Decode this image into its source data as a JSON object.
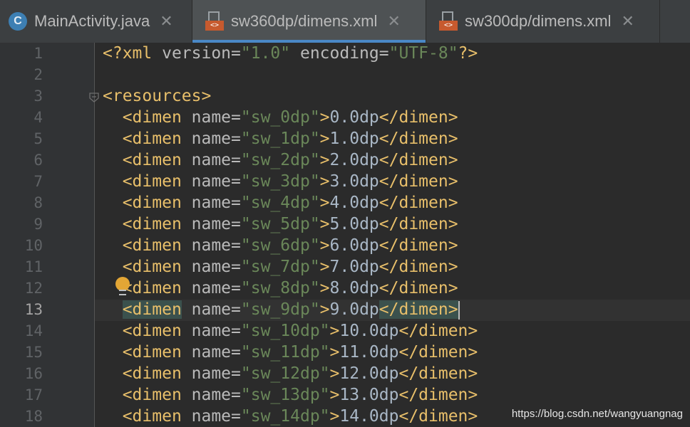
{
  "tabs": [
    {
      "label": "MainActivity.java",
      "icon": "java-class-icon",
      "active": false
    },
    {
      "label": "sw360dp/dimens.xml",
      "icon": "xml-file-icon",
      "active": true
    },
    {
      "label": "sw300dp/dimens.xml",
      "icon": "xml-file-icon",
      "active": false
    }
  ],
  "tab_close_glyph": "✕",
  "java_icon_letter": "C",
  "xml_icon_text": "<>",
  "current_line": 13,
  "line_numbers": [
    "1",
    "2",
    "3",
    "4",
    "5",
    "6",
    "7",
    "8",
    "9",
    "10",
    "11",
    "12",
    "13",
    "14",
    "15",
    "16",
    "17",
    "18"
  ],
  "code": {
    "decl": {
      "open": "<?xml ",
      "a1": "version=",
      "v1": "\"1.0\"",
      "a2": " encoding=",
      "v2": "\"UTF-8\"",
      "close": "?>"
    },
    "root_open": "<resources>",
    "dimens": [
      {
        "name": "\"sw_0dp\"",
        "value": "0.0dp"
      },
      {
        "name": "\"sw_1dp\"",
        "value": "1.0dp"
      },
      {
        "name": "\"sw_2dp\"",
        "value": "2.0dp"
      },
      {
        "name": "\"sw_3dp\"",
        "value": "3.0dp"
      },
      {
        "name": "\"sw_4dp\"",
        "value": "4.0dp"
      },
      {
        "name": "\"sw_5dp\"",
        "value": "5.0dp"
      },
      {
        "name": "\"sw_6dp\"",
        "value": "6.0dp"
      },
      {
        "name": "\"sw_7dp\"",
        "value": "7.0dp"
      },
      {
        "name": "\"sw_8dp\"",
        "value": "8.0dp"
      },
      {
        "name": "\"sw_9dp\"",
        "value": "9.0dp"
      },
      {
        "name": "\"sw_10dp\"",
        "value": "10.0dp"
      },
      {
        "name": "\"sw_11dp\"",
        "value": "11.0dp"
      },
      {
        "name": "\"sw_12dp\"",
        "value": "12.0dp"
      },
      {
        "name": "\"sw_13dp\"",
        "value": "13.0dp"
      },
      {
        "name": "\"sw_14dp\"",
        "value": "14.0dp"
      }
    ],
    "tag_open": "<dimen",
    "attr_name": " name=",
    "tag_gt": ">",
    "tag_close": "</dimen>"
  },
  "watermark": "https://blog.csdn.net/wangyuangnag",
  "colors": {
    "background": "#2b2b2b",
    "tag": "#e8bf6a",
    "string": "#6a8759",
    "text": "#a9b7c6",
    "active_tab_underline": "#4a88c7"
  }
}
